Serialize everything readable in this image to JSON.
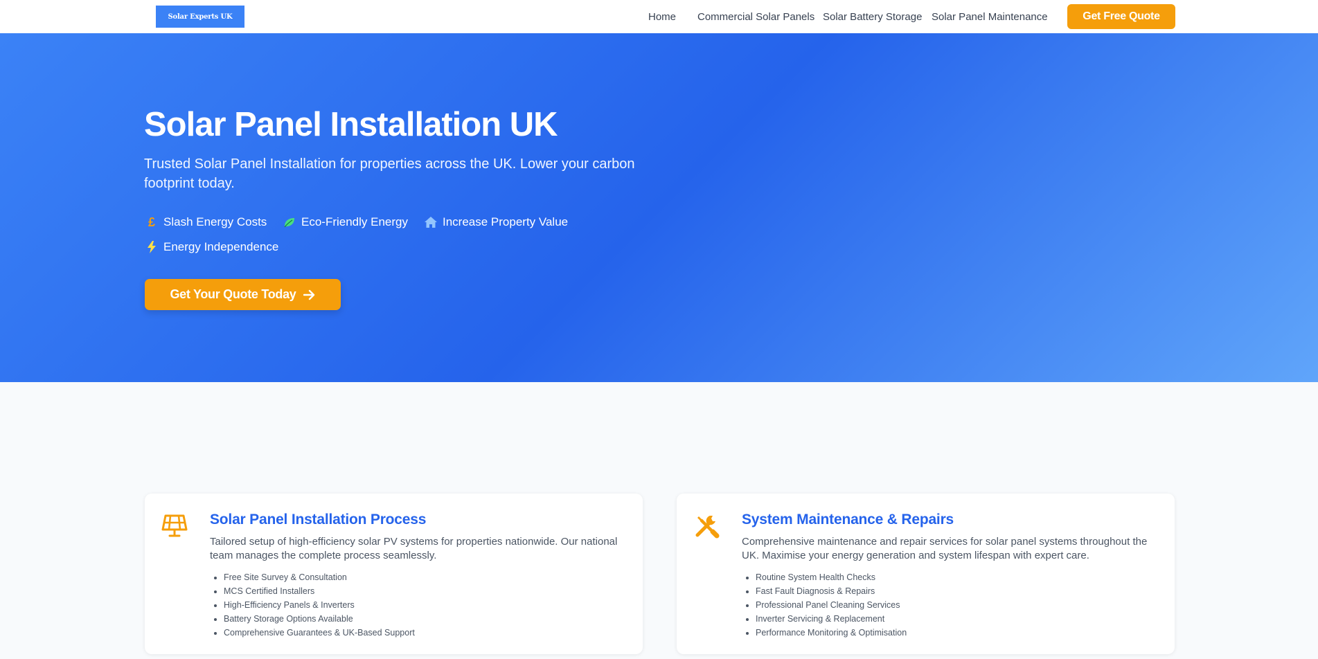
{
  "header": {
    "logo_text": "Solar Experts UK",
    "nav": [
      "Home",
      "Commercial Solar Panels",
      "Solar Battery Storage",
      "Solar Panel Maintenance"
    ],
    "cta_label": "Get Free Quote"
  },
  "hero": {
    "title": "Solar Panel Installation UK",
    "subtitle": "Trusted Solar Panel Installation for properties across the UK. Lower your carbon footprint today.",
    "features": [
      {
        "label": "Slash Energy Costs",
        "icon": "pound-icon"
      },
      {
        "label": "Eco-Friendly Energy",
        "icon": "leaf-icon"
      },
      {
        "label": "Increase Property Value",
        "icon": "home-icon"
      },
      {
        "label": "Energy Independence",
        "icon": "bolt-icon"
      }
    ],
    "cta_label": "Get Your Quote Today"
  },
  "cards": [
    {
      "title": "Solar Panel Installation Process",
      "icon": "solar-panel-icon",
      "description": "Tailored setup of high-efficiency solar PV systems for properties nationwide. Our national team manages the complete process seamlessly.",
      "items": [
        "Free Site Survey & Consultation",
        "MCS Certified Installers",
        "High-Efficiency Panels & Inverters",
        "Battery Storage Options Available",
        "Comprehensive Guarantees & UK-Based Support"
      ]
    },
    {
      "title": "System Maintenance & Repairs",
      "icon": "tools-icon",
      "description": "Comprehensive maintenance and repair services for solar panel systems throughout the UK. Maximise your energy generation and system lifespan with expert care.",
      "items": [
        "Routine System Health Checks",
        "Fast Fault Diagnosis & Repairs",
        "Professional Panel Cleaning Services",
        "Inverter Servicing & Replacement",
        "Performance Monitoring & Optimisation"
      ]
    }
  ],
  "colors": {
    "primary": "#2563eb",
    "accent": "#f59e0b",
    "hero_gradient_start": "#3b82f6",
    "hero_gradient_end": "#60a5fa",
    "leaf": "#4ade80",
    "home": "#93c5fd",
    "bolt": "#fde047"
  }
}
